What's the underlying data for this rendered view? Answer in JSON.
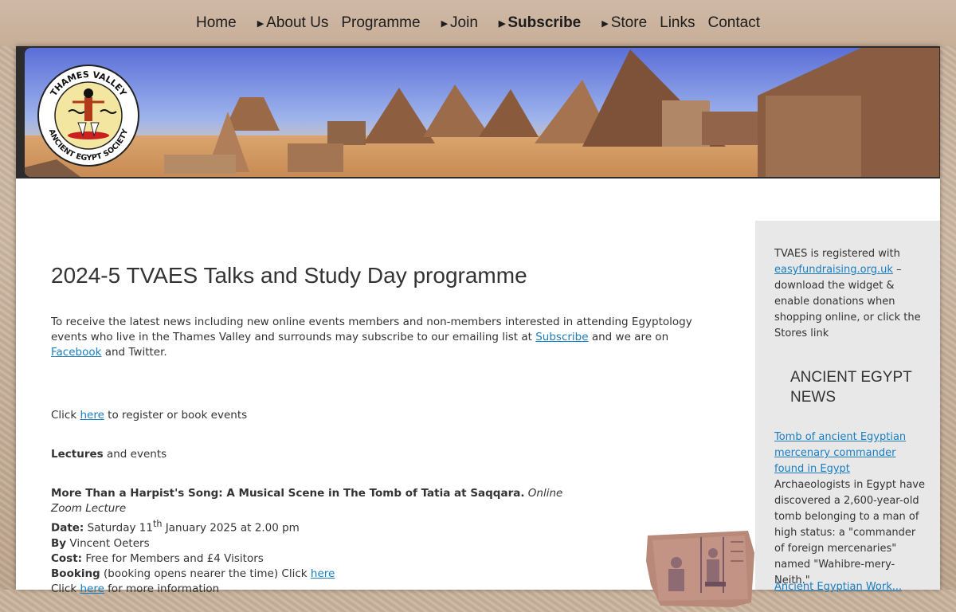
{
  "nav": {
    "items": [
      {
        "label": "Home",
        "caret": false,
        "active": false
      },
      {
        "label": "About Us",
        "caret": true,
        "active": false
      },
      {
        "label": "Programme",
        "caret": false,
        "active": false
      },
      {
        "label": "Join",
        "caret": true,
        "active": false
      },
      {
        "label": "Subscribe",
        "caret": true,
        "active": true
      },
      {
        "label": "Store",
        "caret": true,
        "active": false
      },
      {
        "label": "Links",
        "caret": false,
        "active": false
      },
      {
        "label": "Contact",
        "caret": false,
        "active": false
      }
    ]
  },
  "banner": {
    "logo_top_text": "THAMES VALLEY",
    "logo_bottom_text": "ANCIENT EGYPT SOCIETY"
  },
  "main": {
    "title": "2024-5 TVAES Talks and Study Day programme",
    "intro_before": "To receive the latest news including new online events members and non-members interested in attending Egyptology events who live in the Thames Valley and surrounds may subscribe to our emailing list at ",
    "intro_link1": "Subscribe",
    "intro_mid": " and we are on ",
    "intro_link2": "Facebook",
    "intro_after": " and Twitter.",
    "click_prefix": "Click ",
    "click_link": "here",
    "click_suffix": " to register or book events",
    "lectures_bold": "Lectures",
    "lectures_rest": " and events",
    "event": {
      "title": "More Than a Harpist's Song: A Musical Scene in The Tomb of Tatia at Saqqara.",
      "format": "Online Zoom Lecture",
      "date_label": "Date:",
      "date_pre": " Saturday 11",
      "date_sup": "th",
      "date_post": " January 2025 at 2.00 pm",
      "by_label": "By",
      "by_value": " Vincent Oeters",
      "cost_label": "Cost:",
      "cost_value": " Free for Members and £4 Visitors",
      "booking_label": "Booking",
      "booking_value": " (booking opens nearer the time) Click ",
      "booking_link": "here",
      "more_prefix": "Click ",
      "more_link": "here",
      "more_suffix": " for more information"
    }
  },
  "sidebar": {
    "reg_pre": "TVAES is registered with ",
    "reg_link": "easyfundraising.org.uk",
    "reg_post": " – download the widget & enable donations when shopping online, or click the Stores link",
    "news_heading": "ANCIENT EGYPT NEWS",
    "news_link": "Tomb of ancient Egyptian mercenary commander found in Egypt",
    "news_text": "Archaeologists in Egypt have discovered a 2,600-year-old tomb belonging to a man of high status: a \"commander of foreign mercenaries\" named \"Wahibre-mery-Neith.\"",
    "next_link": "Ancient Egyptian Work..."
  },
  "colors": {
    "link": "#1a7dbf",
    "sidebar_bg": "#e8e8e8",
    "nav_bg": "#cfb9a6"
  }
}
